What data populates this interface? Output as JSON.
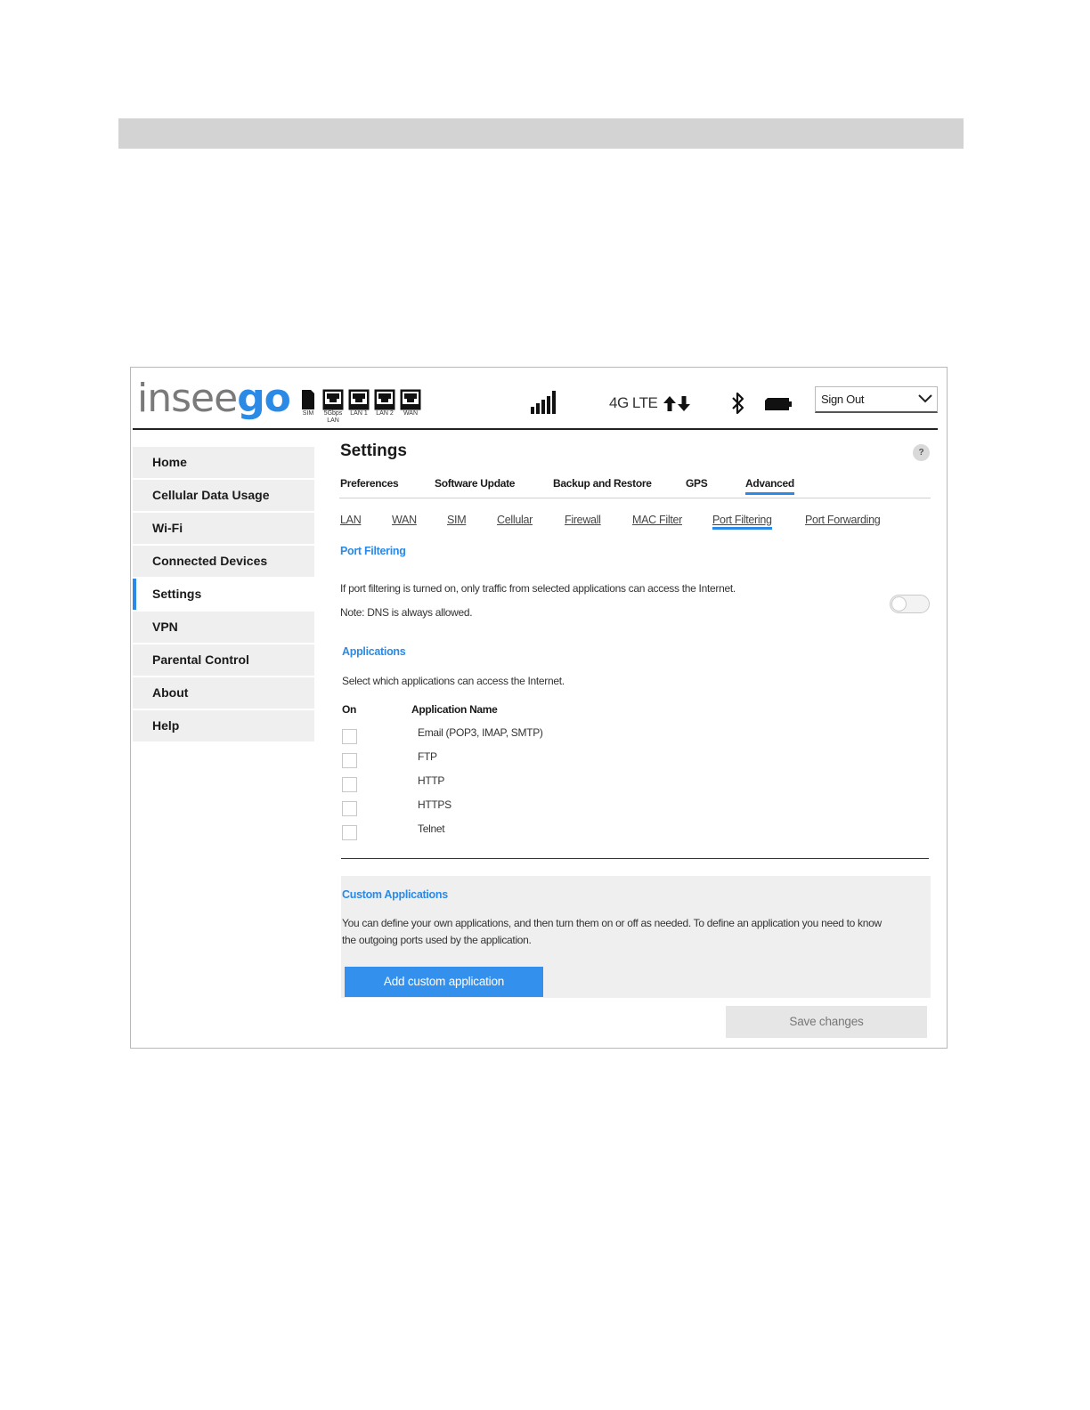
{
  "header": {
    "logo_text_1": "insee",
    "logo_text_2": "go",
    "ports": [
      {
        "label": "SIM",
        "icon": "sim-card-icon"
      },
      {
        "label": "5Gbps\nLAN",
        "icon": "ethernet-port-icon"
      },
      {
        "label": "LAN 1",
        "icon": "ethernet-port-icon"
      },
      {
        "label": "LAN 2",
        "icon": "ethernet-port-icon"
      },
      {
        "label": "WAN",
        "icon": "ethernet-port-icon"
      }
    ],
    "network_type": "4G LTE",
    "signout": {
      "label": "Sign Out"
    },
    "icons": {
      "signal": "signal-bars-icon",
      "data_activity": "up-down-arrows-icon",
      "bluetooth": "bluetooth-icon",
      "battery": "battery-icon"
    },
    "accent_color": "#2a8ae6"
  },
  "sidebar": {
    "items": [
      {
        "label": "Home"
      },
      {
        "label": "Cellular Data Usage"
      },
      {
        "label": "Wi-Fi"
      },
      {
        "label": "Connected Devices"
      },
      {
        "label": "Settings",
        "active": true
      },
      {
        "label": "VPN"
      },
      {
        "label": "Parental Control"
      },
      {
        "label": "About"
      },
      {
        "label": "Help"
      }
    ]
  },
  "main": {
    "title": "Settings",
    "help_label": "?",
    "tabs": [
      {
        "label": "Preferences"
      },
      {
        "label": "Software Update"
      },
      {
        "label": "Backup and Restore"
      },
      {
        "label": "GPS"
      },
      {
        "label": "Advanced",
        "active": true
      }
    ],
    "subtabs": [
      {
        "label": "LAN"
      },
      {
        "label": "WAN"
      },
      {
        "label": "SIM"
      },
      {
        "label": "Cellular"
      },
      {
        "label": "Firewall"
      },
      {
        "label": "MAC Filter"
      },
      {
        "label": "Port Filtering",
        "active": true
      },
      {
        "label": "Port Forwarding"
      }
    ],
    "port_filtering": {
      "title": "Port Filtering",
      "description": "If port filtering is turned on, only traffic from selected applications can access the Internet.",
      "note": "Note: DNS is always allowed.",
      "enabled": false
    },
    "applications": {
      "title": "Applications",
      "description": "Select which applications can access the Internet.",
      "col_on": "On",
      "col_name": "Application Name",
      "rows": [
        {
          "name": "Email (POP3, IMAP, SMTP)",
          "on": false
        },
        {
          "name": "FTP",
          "on": false
        },
        {
          "name": "HTTP",
          "on": false
        },
        {
          "name": "HTTPS",
          "on": false
        },
        {
          "name": "Telnet",
          "on": false
        }
      ]
    },
    "custom": {
      "title": "Custom Applications",
      "description_line1": "You can define your own applications, and then turn them on or off as needed. To define an application you need to know",
      "description_line2": "the outgoing ports used by the application.",
      "add_button": "Add custom application"
    },
    "save_button": "Save changes"
  }
}
